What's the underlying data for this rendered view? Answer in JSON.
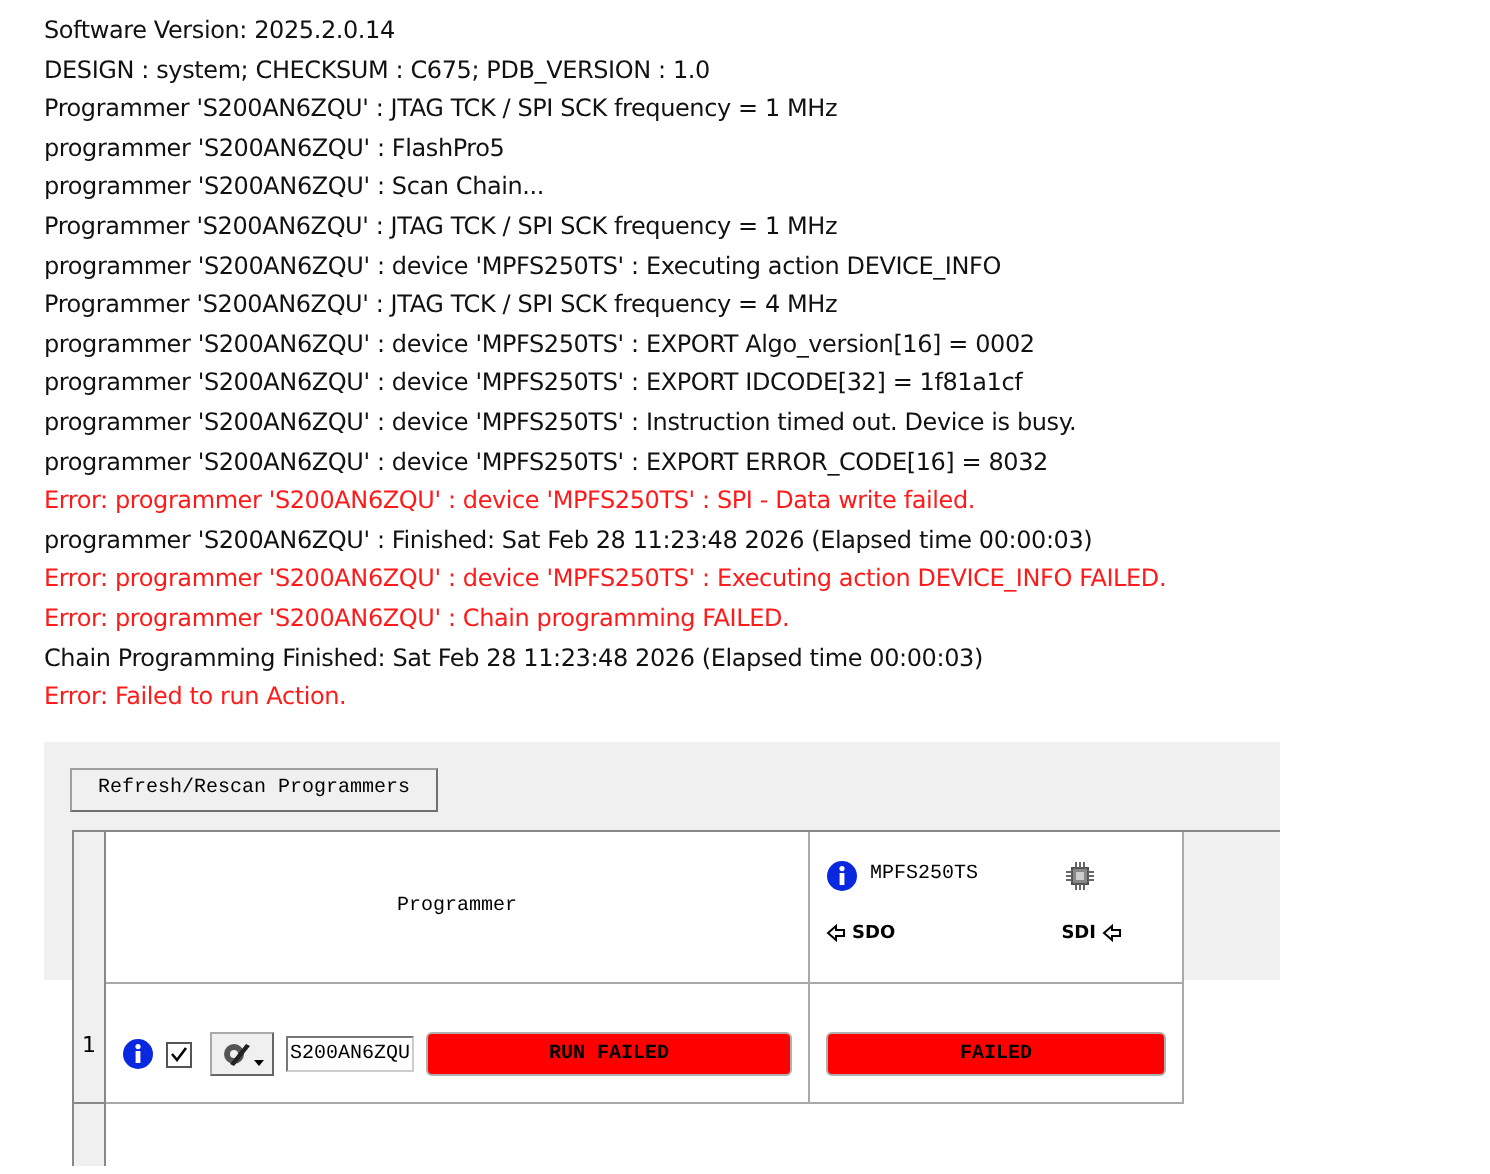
{
  "log": [
    {
      "kind": "info",
      "text": "Software Version: 2025.2.0.14"
    },
    {
      "kind": "info",
      "text": "DESIGN : system; CHECKSUM : C675; PDB_VERSION : 1.0"
    },
    {
      "kind": "info",
      "text": "Programmer 'S200AN6ZQU' : JTAG TCK / SPI SCK frequency = 1 MHz"
    },
    {
      "kind": "info",
      "text": "programmer 'S200AN6ZQU' : FlashPro5"
    },
    {
      "kind": "info",
      "text": "programmer 'S200AN6ZQU' : Scan Chain..."
    },
    {
      "kind": "info",
      "text": "Programmer 'S200AN6ZQU' : JTAG TCK / SPI SCK frequency = 1 MHz"
    },
    {
      "kind": "info",
      "text": "programmer 'S200AN6ZQU' : device 'MPFS250TS' : Executing action DEVICE_INFO"
    },
    {
      "kind": "info",
      "text": "Programmer 'S200AN6ZQU' : JTAG TCK / SPI SCK frequency = 4 MHz"
    },
    {
      "kind": "info",
      "text": "programmer 'S200AN6ZQU' : device 'MPFS250TS' : EXPORT Algo_version[16] = 0002"
    },
    {
      "kind": "info",
      "text": "programmer 'S200AN6ZQU' : device 'MPFS250TS' : EXPORT IDCODE[32] = 1f81a1cf"
    },
    {
      "kind": "info",
      "text": "programmer 'S200AN6ZQU' : device 'MPFS250TS' : Instruction timed out. Device is busy."
    },
    {
      "kind": "info",
      "text": "programmer 'S200AN6ZQU' : device 'MPFS250TS' : EXPORT ERROR_CODE[16] = 8032"
    },
    {
      "kind": "error",
      "text": "Error: programmer 'S200AN6ZQU' : device 'MPFS250TS' : SPI - Data write failed."
    },
    {
      "kind": "info",
      "text": "programmer 'S200AN6ZQU' : Finished: Sat Feb 28 11:23:48 2026 (Elapsed time 00:00:03)"
    },
    {
      "kind": "error",
      "text": "Error: programmer 'S200AN6ZQU' : device 'MPFS250TS' : Executing action DEVICE_INFO FAILED."
    },
    {
      "kind": "error",
      "text": "Error: programmer 'S200AN6ZQU' : Chain programming FAILED."
    },
    {
      "kind": "info",
      "text": "Chain Programming Finished: Sat Feb 28 11:23:48 2026 (Elapsed time 00:00:03)"
    },
    {
      "kind": "error",
      "text": "Error: Failed to run Action."
    }
  ],
  "panel": {
    "refresh_button": "Refresh/Rescan Programmers",
    "header": {
      "programmer": "Programmer",
      "device": "MPFS250TS",
      "sdo": "SDO",
      "sdi": "SDI"
    },
    "rows": [
      {
        "index": "1",
        "checked": true,
        "name": "S200AN6ZQU",
        "status": "RUN FAILED",
        "device_status": "FAILED"
      }
    ]
  }
}
